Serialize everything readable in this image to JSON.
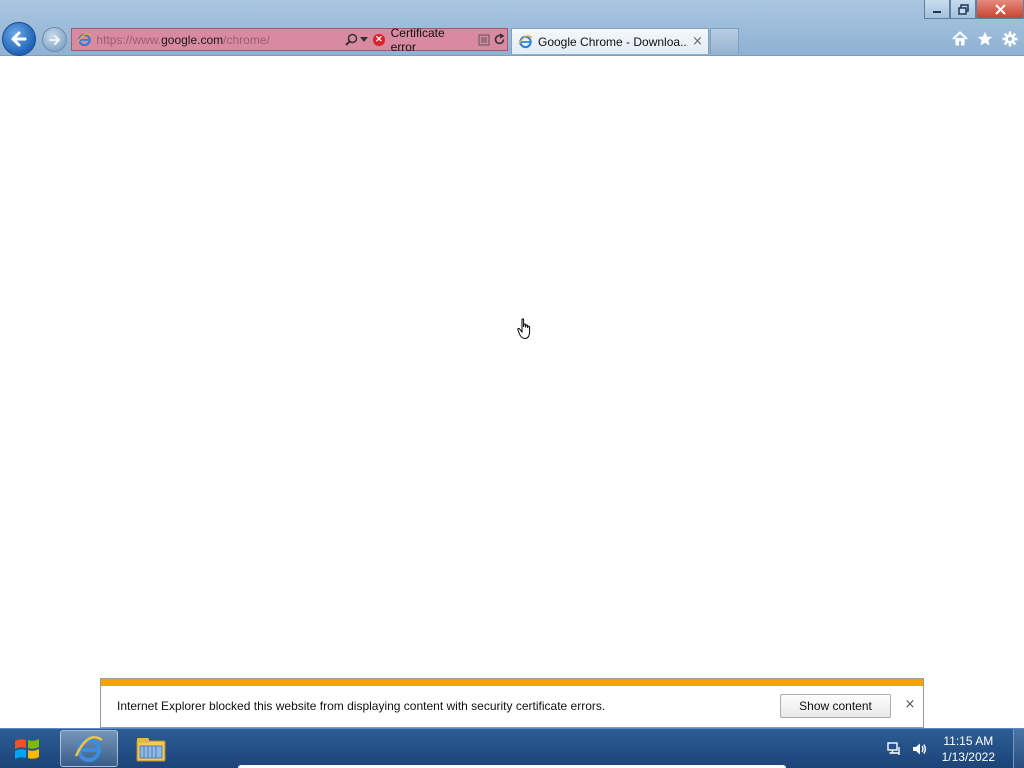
{
  "window_controls": {
    "minimize_icon": "minimize-icon",
    "restore_icon": "restore-icon",
    "close_icon": "close-icon"
  },
  "address_bar": {
    "url_prefix": "https://www.",
    "url_host": "google.com",
    "url_path": "/chrome/",
    "cert_error_label": "Certificate error",
    "background_color": "#d98aa0"
  },
  "tabs": [
    {
      "label": "Google Chrome - Downloa...",
      "close_glyph": "×"
    }
  ],
  "notification": {
    "message": "Internet Explorer blocked this website from displaying content with security certificate errors.",
    "show_content_label": "Show content",
    "close_glyph": "×",
    "accent_color": "#f0a800"
  },
  "taskbar": {
    "items": [
      "ie-icon",
      "file-explorer-icon"
    ],
    "clock": {
      "time": "11:15 AM",
      "date": "1/13/2022"
    }
  }
}
